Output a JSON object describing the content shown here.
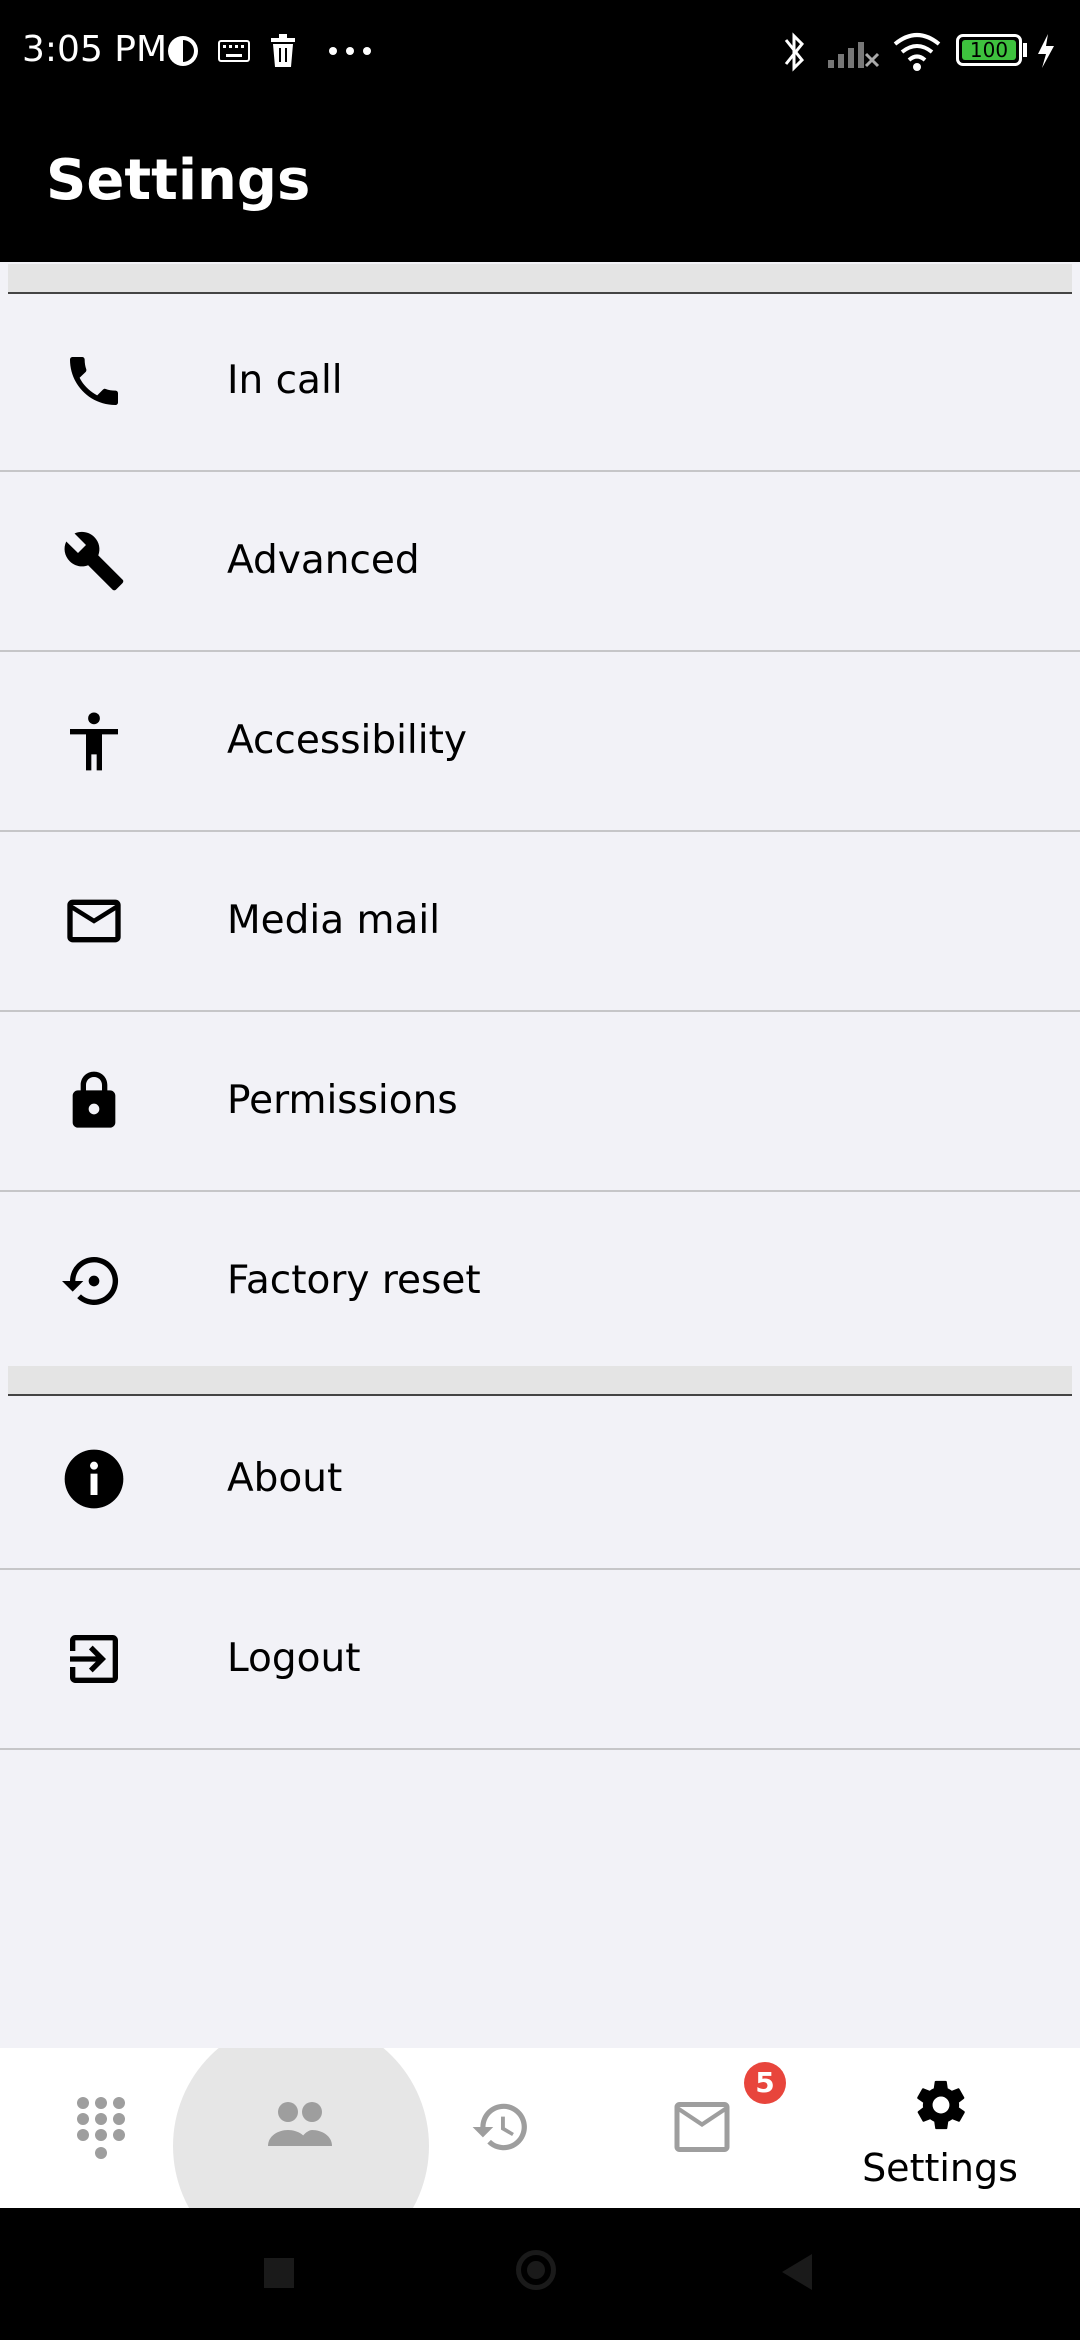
{
  "status_bar": {
    "time": "3:05 PM",
    "battery": "100",
    "icons_left": [
      "ring-icon",
      "keyboard-icon",
      "trash-icon",
      "more-dots-icon"
    ],
    "icons_right": [
      "bluetooth-icon",
      "signal-off-icon",
      "wifi-icon",
      "battery-icon",
      "charging-icon"
    ]
  },
  "app_bar": {
    "title": "Settings"
  },
  "settings": {
    "group1": [
      {
        "label": "In call",
        "icon": "phone-icon"
      },
      {
        "label": "Advanced",
        "icon": "wrench-icon"
      },
      {
        "label": "Accessibility",
        "icon": "accessibility-icon"
      },
      {
        "label": "Media mail",
        "icon": "mail-icon"
      },
      {
        "label": "Permissions",
        "icon": "lock-icon"
      },
      {
        "label": "Factory reset",
        "icon": "reset-icon"
      }
    ],
    "group2": [
      {
        "label": "About",
        "icon": "info-icon"
      },
      {
        "label": "Logout",
        "icon": "logout-icon"
      }
    ]
  },
  "bottom_nav": {
    "items": [
      {
        "icon": "dialpad-icon"
      },
      {
        "icon": "contacts-icon",
        "highlighted": true
      },
      {
        "icon": "history-icon"
      },
      {
        "icon": "mail-icon",
        "badge": "5"
      },
      {
        "icon": "gear-icon",
        "label": "Settings",
        "active": true
      }
    ]
  },
  "colors": {
    "background": "#f2f2f7",
    "bar": "#000000",
    "badge": "#e8453c",
    "inactive_nav": "#9e9e9e"
  }
}
